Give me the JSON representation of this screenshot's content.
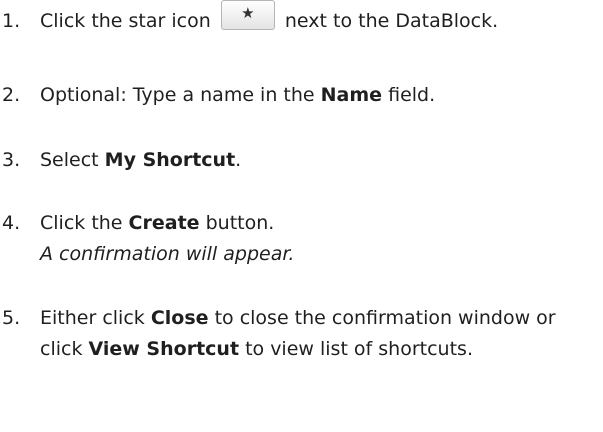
{
  "steps": [
    {
      "number": "1.",
      "before": "Click the star icon",
      "icon": "star-icon",
      "icon_glyph": "★",
      "after": "next to the DataBlock."
    },
    {
      "number": "2.",
      "before": "Optional: Type a name in the",
      "bold": "Name",
      "after": "field."
    },
    {
      "number": "3.",
      "before": "Select",
      "bold": "My Shortcut",
      "after": "."
    },
    {
      "number": "4.",
      "before": "Click the",
      "bold": "Create",
      "after": "button.",
      "note": "A confirmation will appear."
    },
    {
      "number": "5.",
      "before": "Either click",
      "bold": "Close",
      "middle": "to close the confirmation window or click",
      "bold2": "View Shortcut",
      "after": "to view list of shortcuts."
    }
  ]
}
